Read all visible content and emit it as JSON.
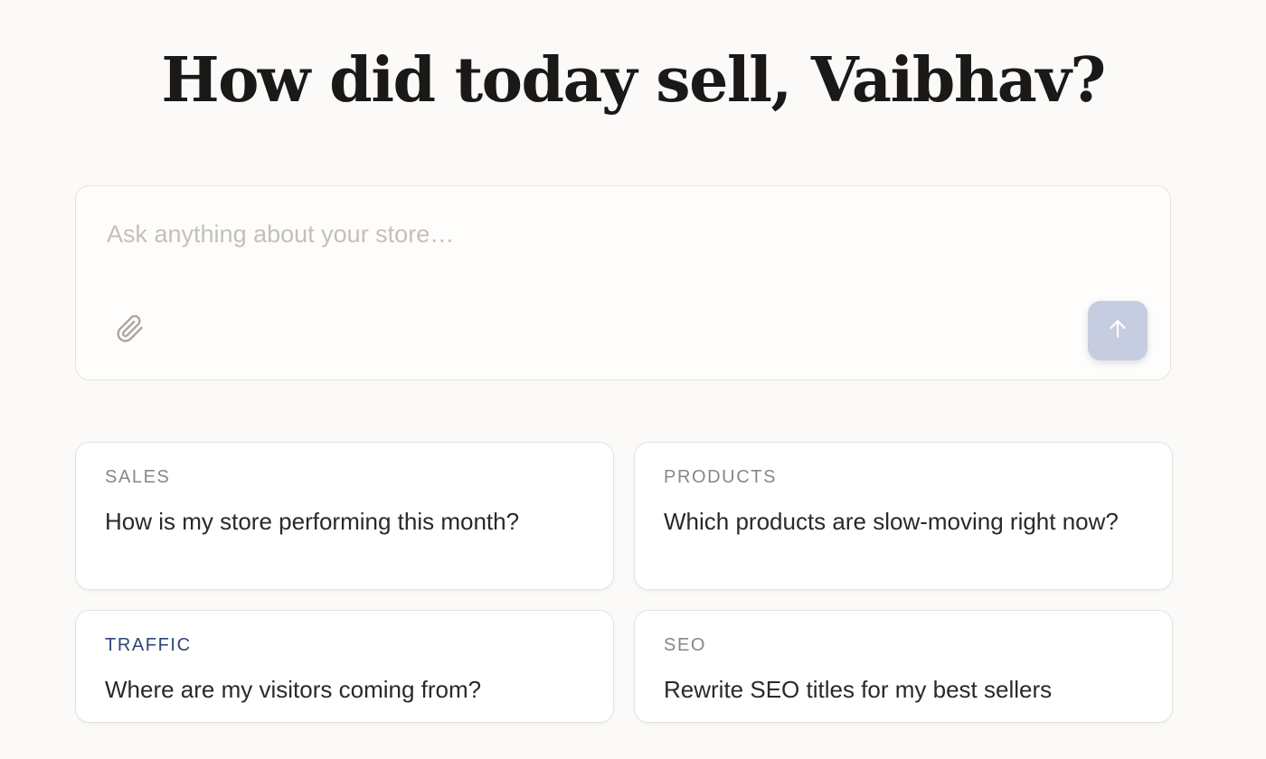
{
  "heading": "How did today sell, Vaibhav?",
  "composer": {
    "placeholder": "Ask anything about your store…",
    "value": "",
    "attach_icon": "paperclip-icon",
    "send_icon": "arrow-up-icon",
    "send_button_color": "#c7cde0"
  },
  "suggestions": [
    {
      "category": "SALES",
      "question": "How is my store performing this month?"
    },
    {
      "category": "PRODUCTS",
      "question": "Which products are slow-moving right now?"
    },
    {
      "category": "TRAFFIC",
      "question": "Where are my visitors coming from?",
      "category_color": "#2f4478"
    },
    {
      "category": "SEO",
      "question": "Rewrite SEO titles for my best sellers"
    }
  ],
  "colors": {
    "background": "#fbfaf8",
    "heading": "#1b1918",
    "accent": "#2f4478",
    "muted_tag": "#8a8784"
  }
}
